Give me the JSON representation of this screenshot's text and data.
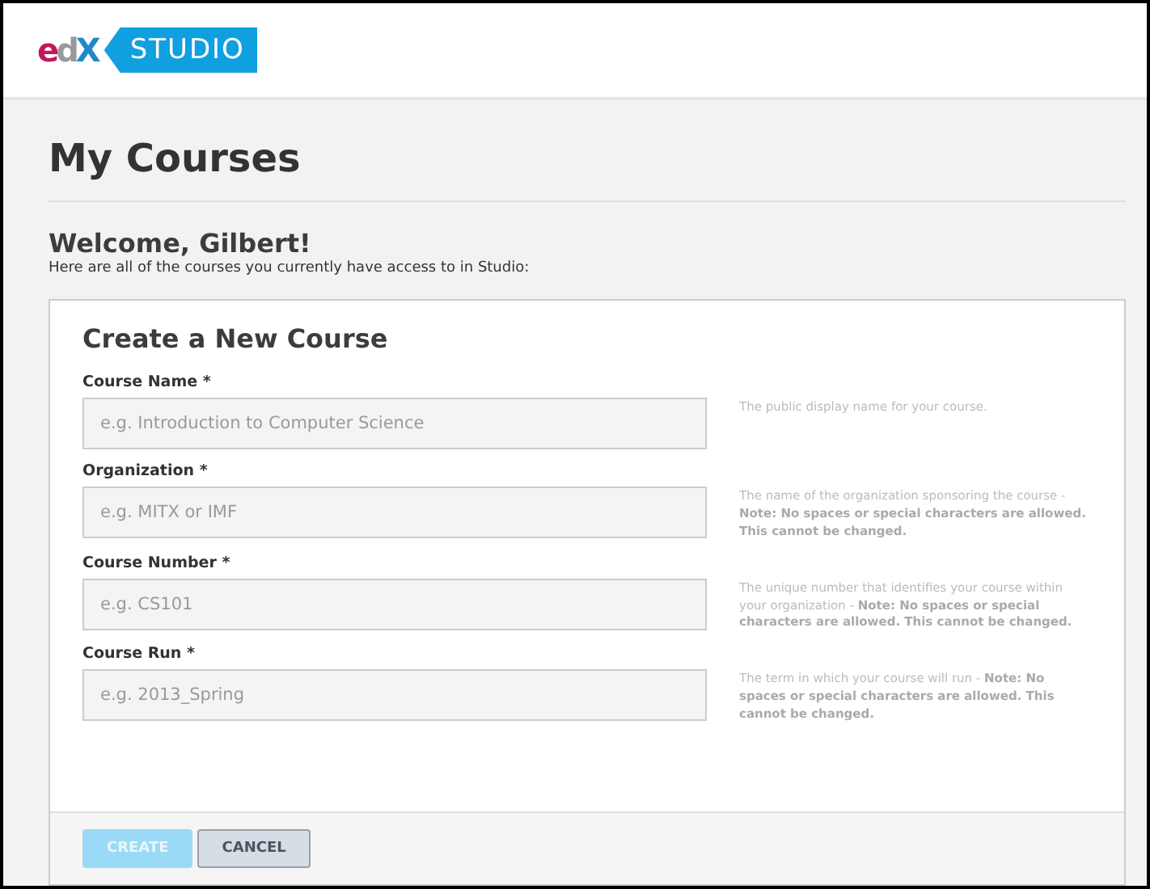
{
  "header": {
    "logo": "edX",
    "product": "STUDIO"
  },
  "page_title": "My Courses",
  "welcome": {
    "heading": "Welcome, Gilbert!",
    "text": "Here are all of the courses you currently have access to in Studio:"
  },
  "form": {
    "title": "Create a New Course",
    "fields": [
      {
        "label": "Course Name *",
        "placeholder": "e.g. Introduction to Computer Science",
        "hint": "The public display name for your course."
      },
      {
        "label": "Organization *",
        "placeholder": "e.g. MITX or IMF",
        "hint": "The name of the organization sponsoring the course - **Note: No spaces or special characters are allowed. This cannot be changed.**"
      },
      {
        "label": "Course Number *",
        "placeholder": "e.g. CS101",
        "hint": "The unique number that identifies your course within your organization - **Note: No spaces or special characters are allowed. This cannot be changed.**"
      },
      {
        "label": "Course Run *",
        "placeholder": "e.g. 2013_Spring",
        "hint": "The term in which your course will run - **Note: No spaces or special characters are allowed. This cannot be changed.**"
      }
    ],
    "buttons": [
      {
        "label": "CREATE",
        "kind": "primary",
        "disabled": true
      },
      {
        "label": "CANCEL",
        "kind": "secondary",
        "disabled": false
      }
    ]
  }
}
